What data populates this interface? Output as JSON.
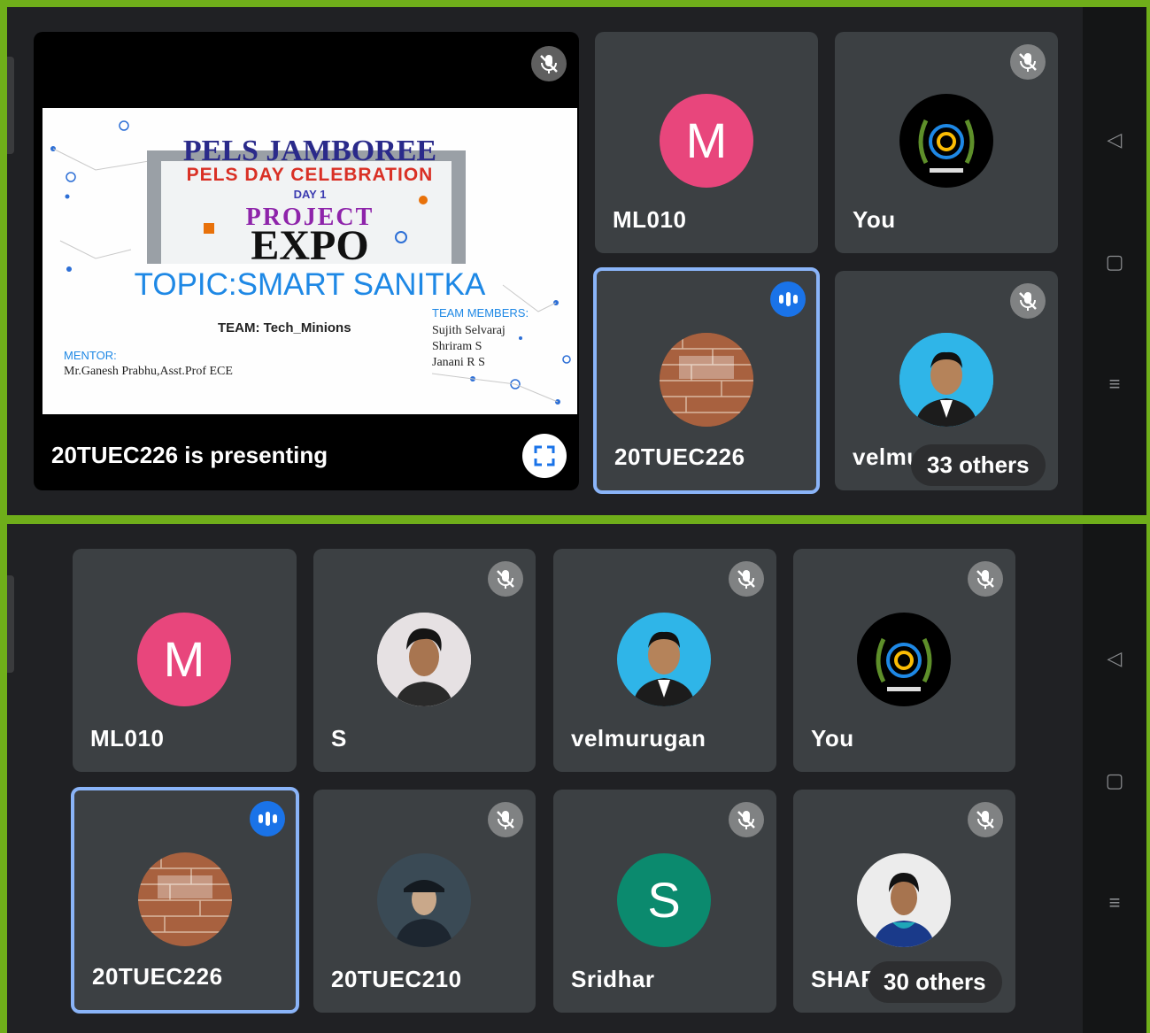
{
  "top": {
    "presentation": {
      "label": "20TUEC226 is presenting",
      "slide": {
        "title": "PELS JAMBOREE",
        "subtitle": "PELS DAY CELEBRATION",
        "day": "DAY 1",
        "project": "PROJECT",
        "expo": "EXPO",
        "topic": "TOPIC:SMART SANITKA",
        "team": "TEAM: Tech_Minions",
        "members_title": "TEAM MEMBERS:",
        "members": [
          "Sujith Selvaraj",
          "Shriram S",
          "Janani R S"
        ],
        "mentor_title": "MENTOR:",
        "mentor": "Mr.Ganesh Prabhu,Asst.Prof ECE"
      }
    },
    "tiles": [
      {
        "name": "ML010",
        "avatar_letter": "M",
        "avatar_color": "#e8467c"
      },
      {
        "name": "You",
        "avatar": "emblem-logo"
      },
      {
        "name": "20TUEC226",
        "avatar": "brick-wall-photo",
        "status": "speaking"
      },
      {
        "name": "velmu",
        "avatar": "person-photo"
      }
    ],
    "others": "33 others"
  },
  "bottom": {
    "tiles": [
      {
        "name": "ML010",
        "avatar_letter": "M",
        "avatar_color": "#e8467c"
      },
      {
        "name": "S",
        "avatar": "person-photo"
      },
      {
        "name": "velmurugan",
        "avatar": "person-photo"
      },
      {
        "name": "You",
        "avatar": "emblem-logo"
      },
      {
        "name": "20TUEC226",
        "avatar": "brick-wall-photo",
        "status": "speaking"
      },
      {
        "name": "20TUEC210",
        "avatar": "person-photo"
      },
      {
        "name": "Sridhar",
        "avatar_letter": "S",
        "avatar_color": "#0b8a6e"
      },
      {
        "name": "SHAR",
        "avatar": "person-photo"
      }
    ],
    "others": "30 others"
  },
  "colors": {
    "background": "#202124",
    "tile": "#3c4043",
    "active_border": "#8ab4f8",
    "speaking": "#1a73e8",
    "frame": "#6fae1a"
  }
}
